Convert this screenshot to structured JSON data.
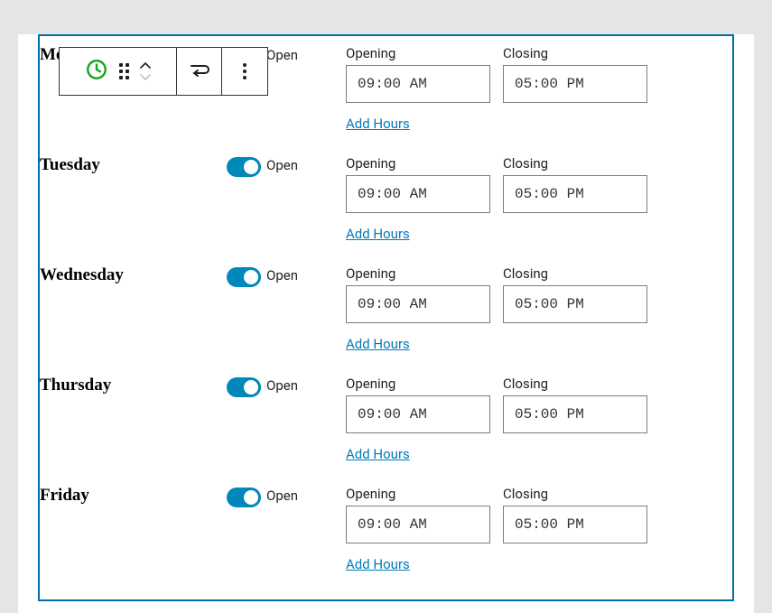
{
  "toolbar": {
    "block_type": "business-hours"
  },
  "labels": {
    "opening": "Opening",
    "closing": "Closing",
    "add_hours": "Add Hours",
    "open": "Open"
  },
  "days": [
    {
      "name": "Monday",
      "open": true,
      "opening": "09:00 AM",
      "closing": "05:00 PM"
    },
    {
      "name": "Tuesday",
      "open": true,
      "opening": "09:00 AM",
      "closing": "05:00 PM"
    },
    {
      "name": "Wednesday",
      "open": true,
      "opening": "09:00 AM",
      "closing": "05:00 PM"
    },
    {
      "name": "Thursday",
      "open": true,
      "opening": "09:00 AM",
      "closing": "05:00 PM"
    },
    {
      "name": "Friday",
      "open": true,
      "opening": "09:00 AM",
      "closing": "05:00 PM"
    }
  ]
}
